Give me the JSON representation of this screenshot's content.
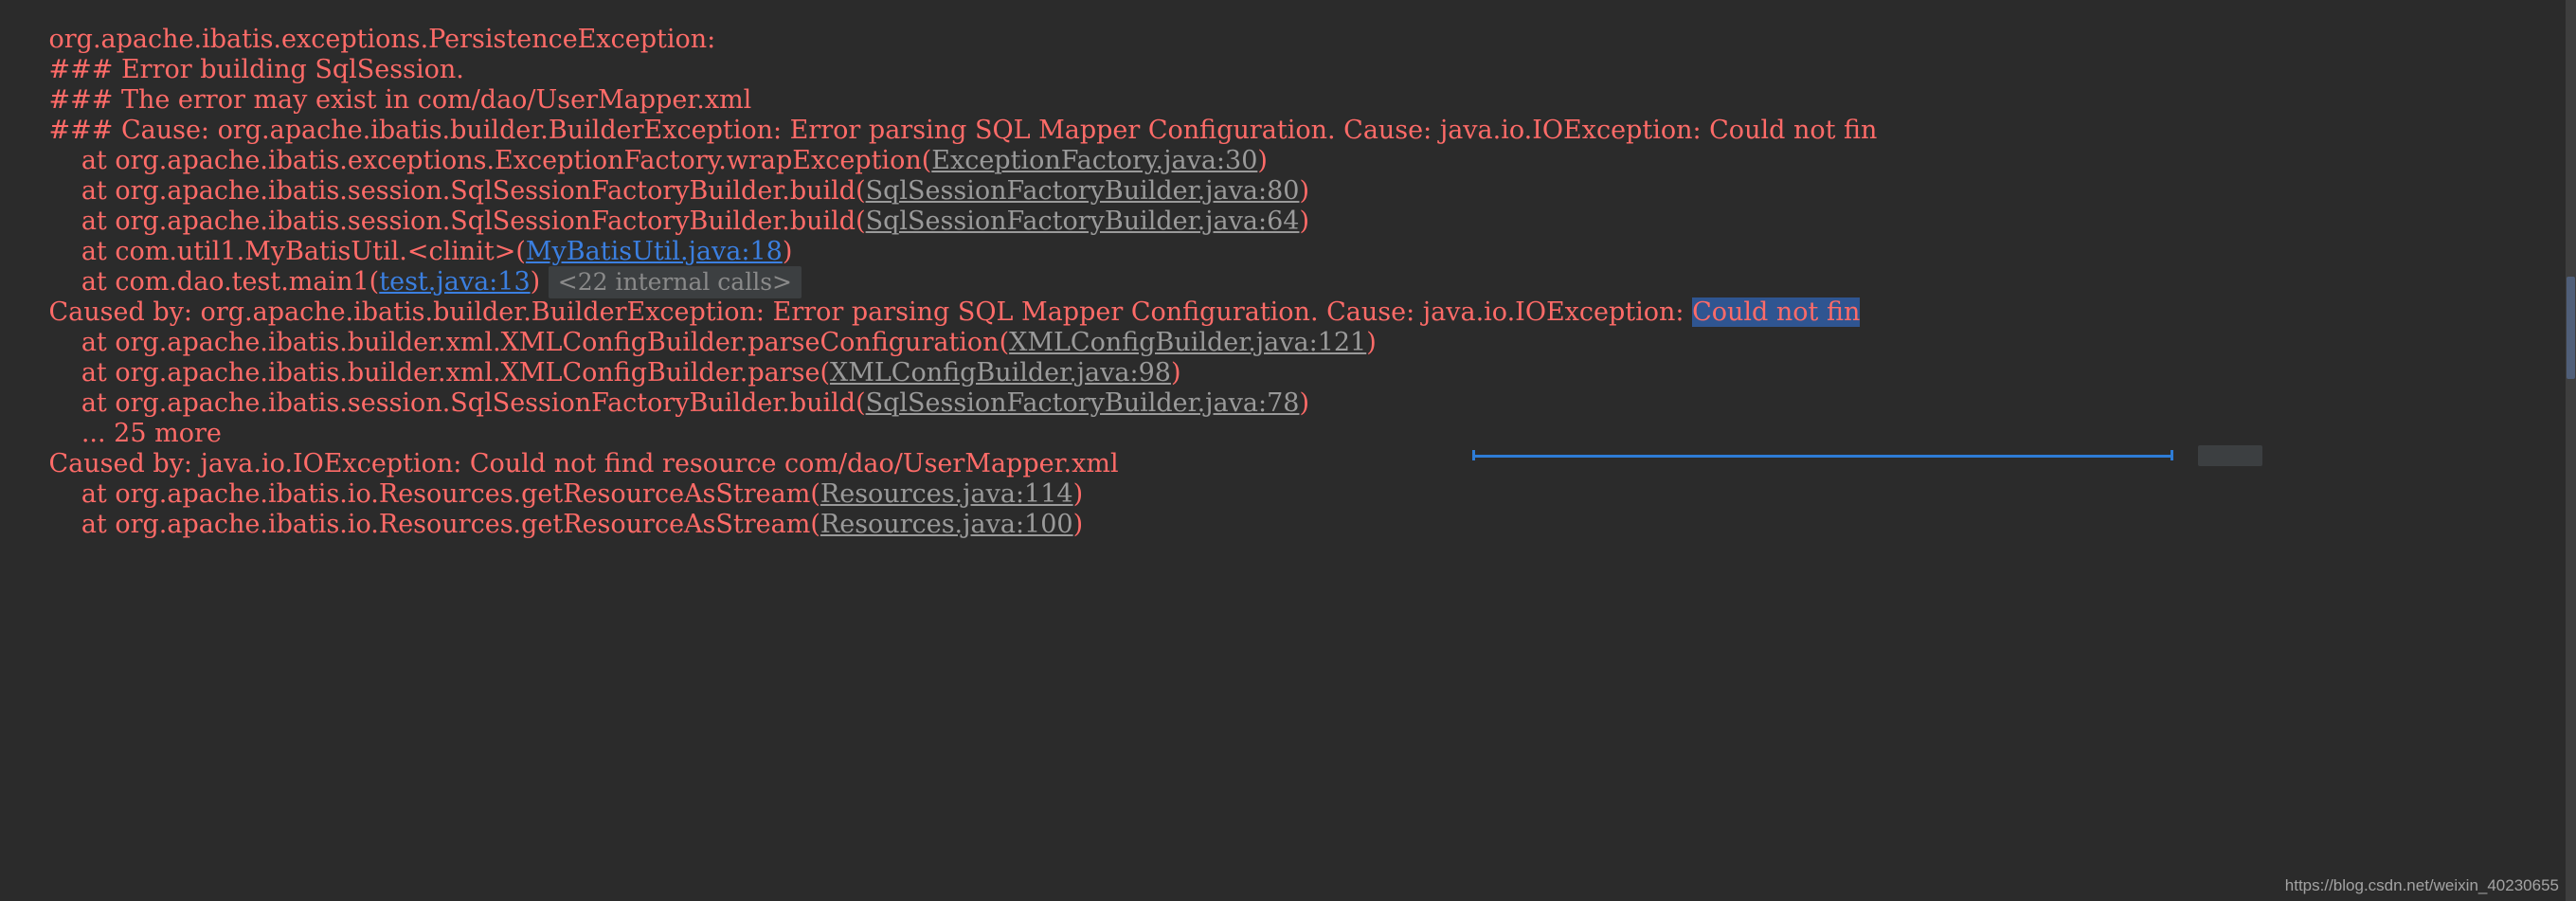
{
  "console": {
    "background_color": "#2B2B2B",
    "error_text_color": "#FF6B68",
    "library_link_color": "#9A9A9A",
    "project_link_color": "#3B7FE0",
    "selection_color": "#2F5591",
    "folded_chip_color": "#3C3F41",
    "scrollbar_color": "#3E3E3E"
  },
  "lines": {
    "l0": "org.apache.ibatis.exceptions.PersistenceException:",
    "l1": "### Error building SqlSession.",
    "l2": "### The error may exist in com/dao/UserMapper.xml",
    "l3": "### Cause: org.apache.ibatis.builder.BuilderException: Error parsing SQL Mapper Configuration. Cause: java.io.IOException: Could not fin",
    "l4_pre": "    at org.apache.ibatis.exceptions.ExceptionFactory.wrapException(",
    "l4_link": "ExceptionFactory.java:30",
    "l4_post": ")",
    "l5_pre": "    at org.apache.ibatis.session.SqlSessionFactoryBuilder.build(",
    "l5_link": "SqlSessionFactoryBuilder.java:80",
    "l5_post": ")",
    "l6_pre": "    at org.apache.ibatis.session.SqlSessionFactoryBuilder.build(",
    "l6_link": "SqlSessionFactoryBuilder.java:64",
    "l6_post": ")",
    "l7_pre": "    at com.util1.MyBatisUtil.<clinit>(",
    "l7_link": "MyBatisUtil.java:18",
    "l7_post": ")",
    "l8_pre": "    at com.dao.test.main1(",
    "l8_link": "test.java:13",
    "l8_post": ")",
    "l8_folded": "<22 internal calls>",
    "l9_pre": "Caused by: org.apache.ibatis.builder.BuilderException: Error parsing SQL Mapper Configuration. Cause: java.io.IOException: ",
    "l9_selected": "Could not fin",
    "l10_pre": "    at org.apache.ibatis.builder.xml.XMLConfigBuilder.parseConfiguration(",
    "l10_link": "XMLConfigBuilder.java:121",
    "l10_post": ")",
    "l11_pre": "    at org.apache.ibatis.builder.xml.XMLConfigBuilder.parse(",
    "l11_link": "XMLConfigBuilder.java:98",
    "l11_post": ")",
    "l12_pre": "    at org.apache.ibatis.session.SqlSessionFactoryBuilder.build(",
    "l12_link": "SqlSessionFactoryBuilder.java:78",
    "l12_post": ")",
    "l13": "    ... 25 more",
    "l14": "Caused by: java.io.IOException: Could not find resource com/dao/UserMapper.xml",
    "l15_pre": "    at org.apache.ibatis.io.Resources.getResourceAsStream(",
    "l15_link": "Resources.java:114",
    "l15_post": ")",
    "l16_pre": "    at org.apache.ibatis.io.Resources.getResourceAsStream(",
    "l16_link": "Resources.java:100",
    "l16_post": ")"
  },
  "watermark": {
    "text": "https://blog.csdn.net/weixin_40230655"
  }
}
